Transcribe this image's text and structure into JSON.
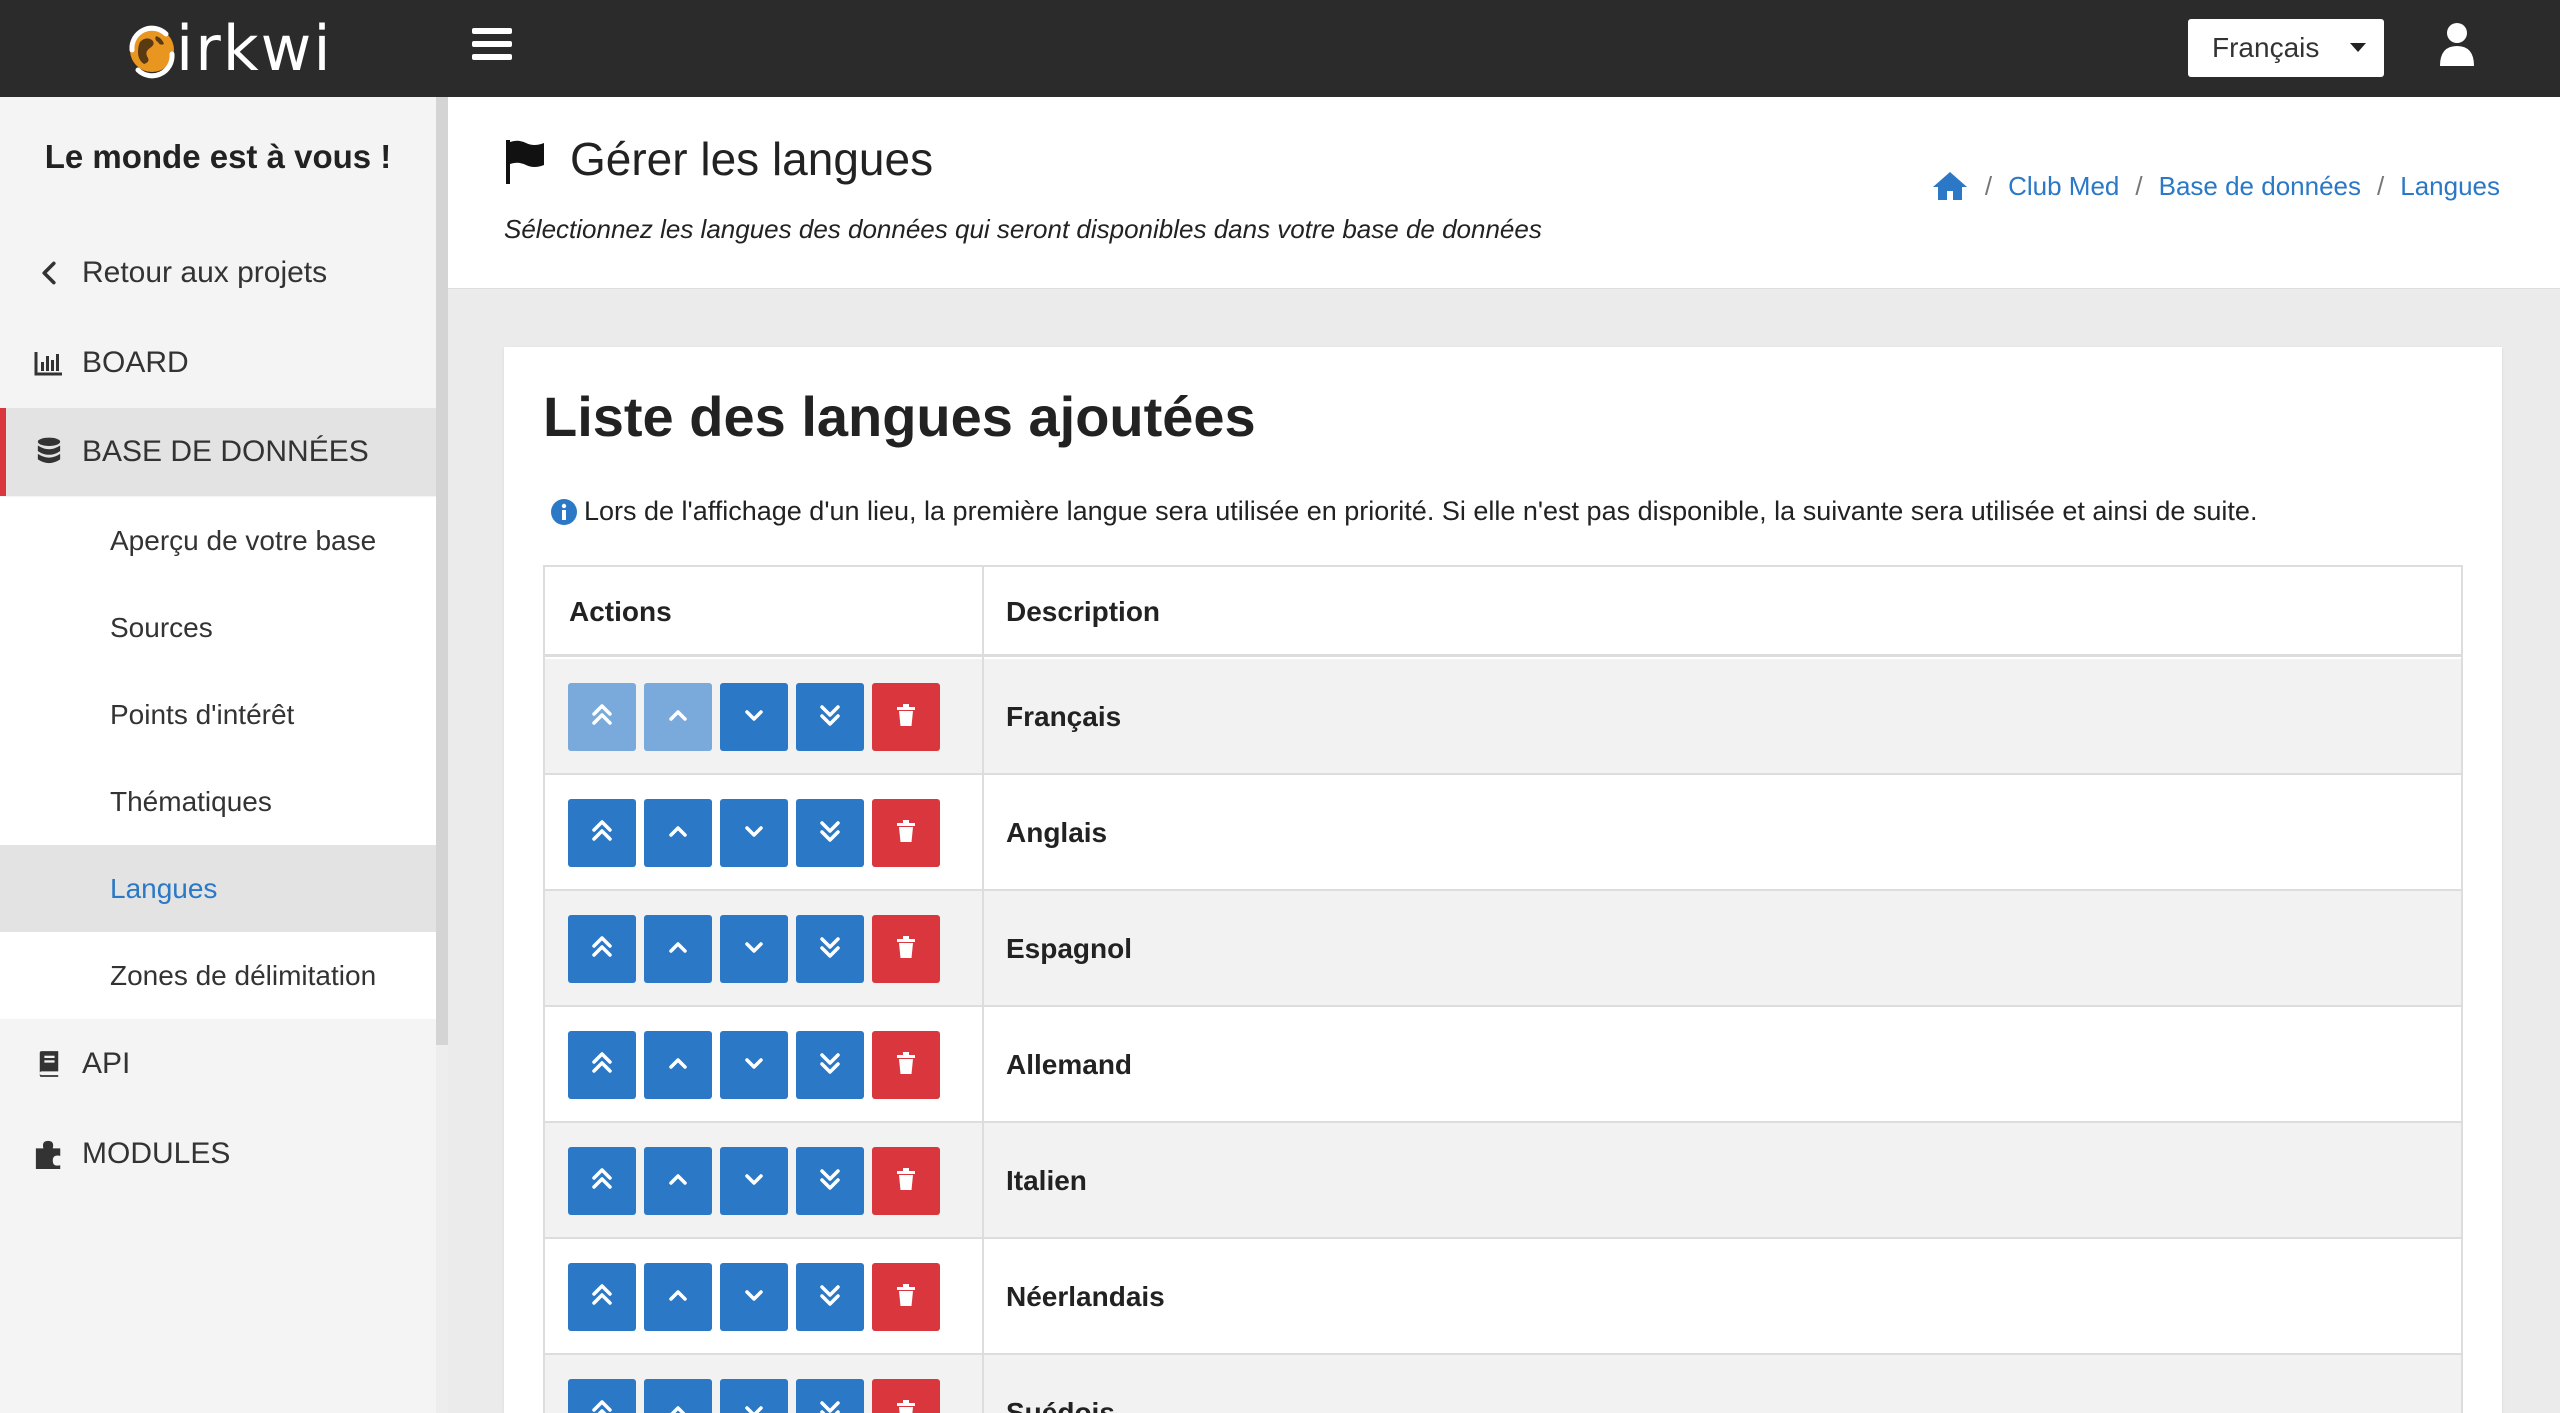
{
  "app": {
    "logo_text": "irkwi"
  },
  "header": {
    "language_selected": "Français"
  },
  "sidebar": {
    "tagline": "Le monde est à vous !",
    "items": [
      {
        "label": "Retour aux projets",
        "icon": "chevron-left-icon"
      },
      {
        "label": "BOARD",
        "icon": "bar-chart-icon"
      },
      {
        "label": "BASE DE DONNÉES",
        "icon": "database-icon"
      },
      {
        "label": "API",
        "icon": "book-icon"
      },
      {
        "label": "MODULES",
        "icon": "puzzle-icon"
      }
    ],
    "subitems": [
      {
        "label": "Aperçu de votre base"
      },
      {
        "label": "Sources"
      },
      {
        "label": "Points d'intérêt"
      },
      {
        "label": "Thématiques"
      },
      {
        "label": "Langues"
      },
      {
        "label": "Zones de délimitation"
      }
    ]
  },
  "page": {
    "title": "Gérer les langues",
    "subtitle": "Sélectionnez les langues des données qui seront disponibles dans votre base de données",
    "breadcrumb": [
      "Club Med",
      "Base de données",
      "Langues"
    ]
  },
  "card": {
    "title": "Liste des langues ajoutées",
    "info": "Lors de l'affichage d'un lieu, la première langue sera utilisée en priorité. Si elle n'est pas disponible, la suivante sera utilisée et ainsi de suite.",
    "columns": [
      "Actions",
      "Description"
    ],
    "rows": [
      {
        "name": "Français"
      },
      {
        "name": "Anglais"
      },
      {
        "name": "Espagnol"
      },
      {
        "name": "Allemand"
      },
      {
        "name": "Italien"
      },
      {
        "name": "Néerlandais"
      },
      {
        "name": "Suédois"
      }
    ]
  },
  "colors": {
    "topbar": "#2b2b2b",
    "primary": "#2a78c6",
    "danger": "#d9363e",
    "primary_disabled": "#7aa9dc"
  }
}
